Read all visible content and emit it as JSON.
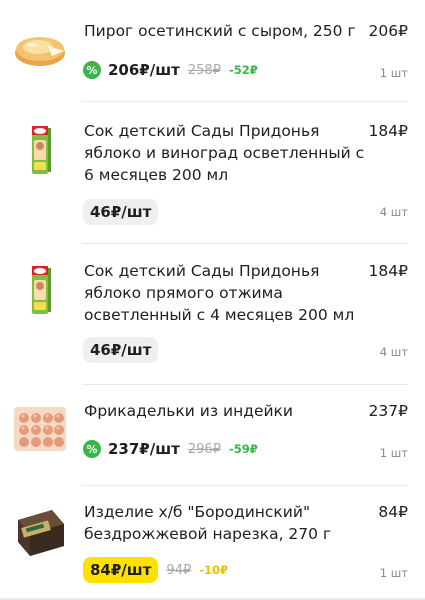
{
  "items": [
    {
      "name": "Пирог осетинский с сыром, 250 г",
      "total": "206₽",
      "unit_price": "206₽/шт",
      "old_price": "258₽",
      "discount": "-52₽",
      "qty": "1 шт",
      "discount_icon": "percent-badge-icon"
    },
    {
      "name": "Сок детский Сады Придонья яблоко и виноград осветленный с 6 месяцев 200 мл",
      "total": "184₽",
      "unit_price": "46₽/шт",
      "qty": "4 шт"
    },
    {
      "name": "Сок детский Сады Придонья яблоко прямого отжима осветленный с 4 месяцев 200 мл",
      "total": "184₽",
      "unit_price": "46₽/шт",
      "qty": "4 шт"
    },
    {
      "name": "Фрикадельки из индейки",
      "total": "237₽",
      "unit_price": "237₽/шт",
      "old_price": "296₽",
      "discount": "-59₽",
      "qty": "1 шт",
      "discount_icon": "percent-badge-icon"
    },
    {
      "name": "Изделие х/б \"Бородинский\" бездрожжевой нарезка, 270 г",
      "total": "84₽",
      "unit_price": "84₽/шт",
      "old_price": "94₽",
      "discount": "-10₽",
      "qty": "1 шт"
    }
  ],
  "colors": {
    "discount_green": "#39b54a",
    "promo_yellow": "#ffe100",
    "pill_gray": "#efefef"
  }
}
